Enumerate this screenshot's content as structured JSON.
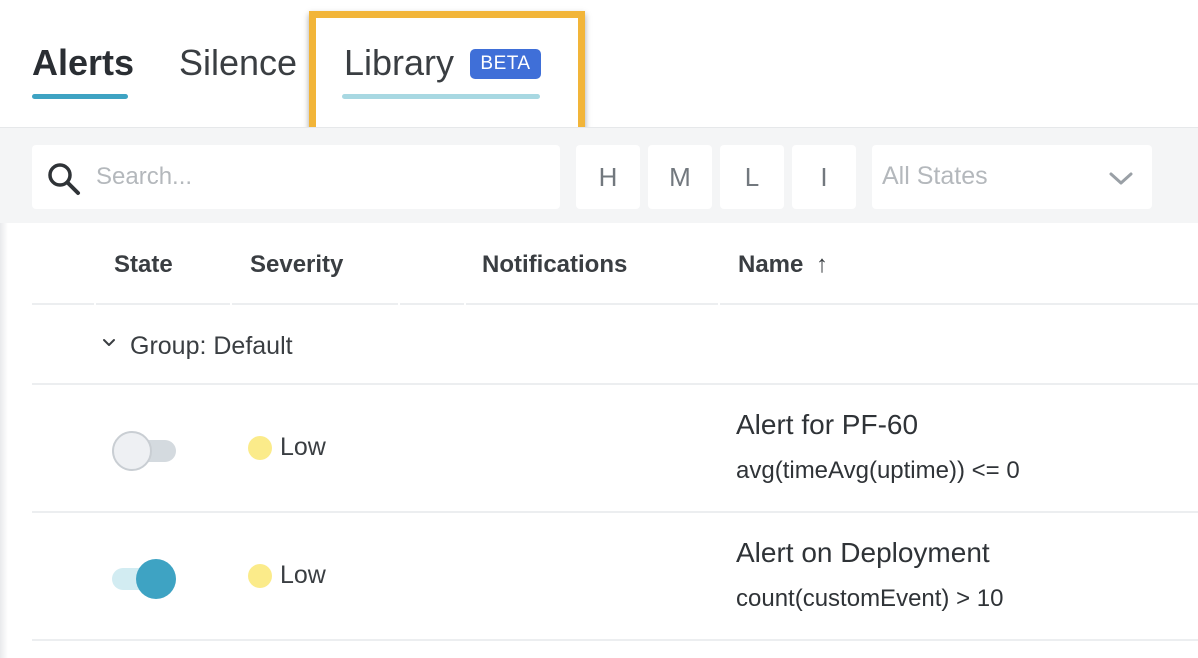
{
  "tabs": [
    {
      "label": "Alerts",
      "active": true
    },
    {
      "label": "Silence",
      "active": false
    },
    {
      "label": "Library",
      "active": false,
      "badge": "BETA"
    }
  ],
  "filters": {
    "search_placeholder": "Search...",
    "severity_buttons": [
      "H",
      "M",
      "L",
      "I"
    ],
    "state_select": "All States"
  },
  "table": {
    "columns": [
      "State",
      "Severity",
      "Notifications",
      "Name"
    ],
    "sort_indicator": "↑",
    "group_label": "Group: Default",
    "rows": [
      {
        "state": "off",
        "severity": "Low",
        "name": "Alert for PF-60",
        "query": "avg(timeAvg(uptime)) <= 0"
      },
      {
        "state": "on",
        "severity": "Low",
        "name": "Alert on Deployment",
        "query": "count(customEvent) > 10"
      }
    ]
  },
  "colors": {
    "accent": "#3ea3c3",
    "library_underline": "#a8d8e2",
    "badge": "#3f6fd8",
    "highlight": "#f2b539",
    "severity_low": "#fbeb8a"
  },
  "icons": {
    "search": "magnifier",
    "dropdown": "chevron-down",
    "group": "chevron-down-small",
    "sort": "arrow-up"
  }
}
